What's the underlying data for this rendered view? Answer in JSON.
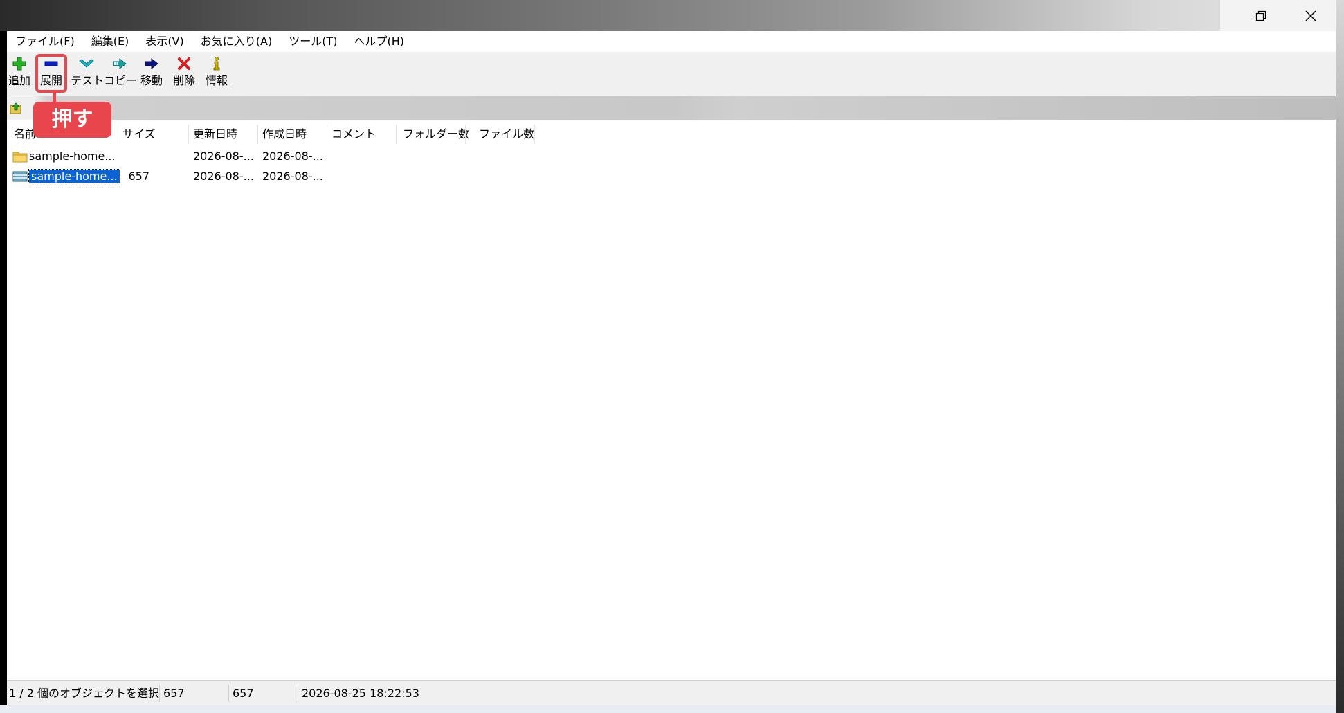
{
  "menu": [
    "ファイル(F)",
    "編集(E)",
    "表示(V)",
    "お気に入り(A)",
    "ツール(T)",
    "ヘルプ(H)"
  ],
  "toolbar": {
    "buttons": [
      {
        "label": "追加",
        "icon": "plus-icon",
        "color": "#22b222"
      },
      {
        "label": "展開",
        "icon": "minus-icon",
        "color": "#0a1ec8"
      },
      {
        "label": "テスト",
        "icon": "check-icon",
        "color": "#18b4c8"
      },
      {
        "label": "コピー",
        "icon": "copy-arrow-icon",
        "color": "#18a0a0"
      },
      {
        "label": "移動",
        "icon": "move-arrow-icon",
        "color": "#0a1480"
      },
      {
        "label": "削除",
        "icon": "delete-x-icon",
        "color": "#d81e1e"
      },
      {
        "label": "情報",
        "icon": "info-icon",
        "color": "#c8b400"
      }
    ]
  },
  "callout": {
    "text": "押す",
    "color": "#e8464c"
  },
  "columns": [
    "名前",
    "サイズ",
    "更新日時",
    "作成日時",
    "コメント",
    "フォルダー数",
    "ファイル数"
  ],
  "rows": [
    {
      "name": "sample-home...",
      "size": "",
      "modified": "2026-08-...",
      "created": "2026-08-...",
      "type": "folder",
      "selected": false
    },
    {
      "name": "sample-home...",
      "size": "657",
      "modified": "2026-08-...",
      "created": "2026-08-...",
      "type": "archive",
      "selected": true
    }
  ],
  "status": {
    "selection": "1 / 2 個のオブジェクトを選択",
    "size1": "657",
    "size2": "657",
    "datetime": "2026-08-25 18:22:53"
  },
  "colors": {
    "selection": "#0a64d6",
    "accent": "#e5484d"
  }
}
